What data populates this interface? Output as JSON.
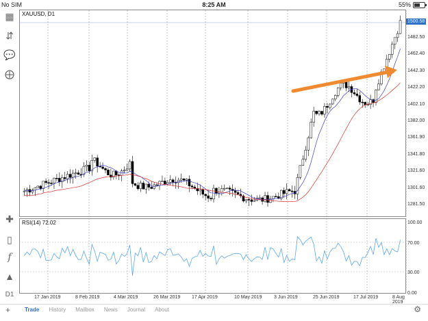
{
  "status": {
    "carrier": "No SIM",
    "time": "8:25 AM",
    "battery": "55%",
    "battery_level": 0.55
  },
  "chart": {
    "symbol": "XAUUSD, D1",
    "rsi_label": "RSI(14) 72.02",
    "current_price": "1500.58",
    "price_labels": [
      "1482.50",
      "1462.40",
      "1442.30",
      "1422.20",
      "1402.10",
      "1382.00",
      "1361.90",
      "1341.80",
      "1321.60",
      "1301.60",
      "1281.50"
    ],
    "rsi_labels": [
      "100.00",
      "70.00",
      "30.00",
      "0.00"
    ],
    "date_labels": [
      "17 Jan 2019",
      "8 Feb 2019",
      "4 Mar 2019",
      "26 Mar 2019",
      "17 Apr 2019",
      "10 May 2019",
      "3 Jun 2019",
      "25 Jun 2019",
      "17 Jul 2019",
      "8 Aug 2019"
    ],
    "colors": {
      "bull": "#ffffff",
      "bear": "#000000",
      "ma_fast": "#3b3bd6",
      "ma_slow": "#e03030",
      "rsi": "#5aa8f0",
      "arrow": "#f08a30",
      "price_tag": "#2f6fc4"
    }
  },
  "toolbar": {
    "icons": [
      "crosshair-icon",
      "candles-icon",
      "function-icon",
      "shapes-icon",
      "timeframe-icon"
    ],
    "timeframe": "D1"
  },
  "tabs": [
    {
      "label": "Trade",
      "active": true
    },
    {
      "label": "History",
      "active": false
    },
    {
      "label": "Mailbox",
      "active": false
    },
    {
      "label": "News",
      "active": false
    },
    {
      "label": "Journal",
      "active": false
    },
    {
      "label": "About",
      "active": false
    }
  ]
}
